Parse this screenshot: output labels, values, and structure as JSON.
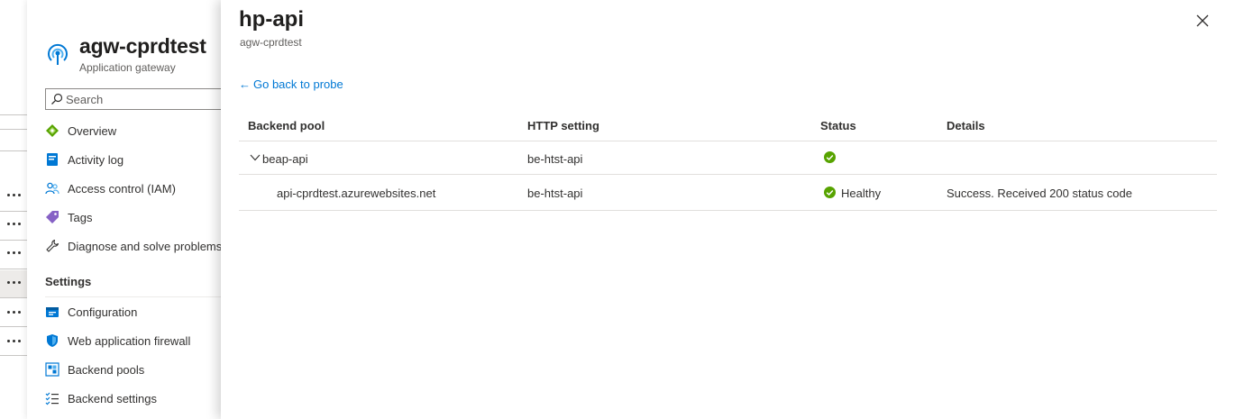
{
  "resource": {
    "name": "agw-cprdtest",
    "type": "Application gateway",
    "search_placeholder": "Search"
  },
  "nav": {
    "items": [
      {
        "label": "Overview",
        "icon": "overview-icon"
      },
      {
        "label": "Activity log",
        "icon": "activity-log-icon"
      },
      {
        "label": "Access control (IAM)",
        "icon": "people-icon"
      },
      {
        "label": "Tags",
        "icon": "tag-icon"
      },
      {
        "label": "Diagnose and solve problems",
        "icon": "wrench-icon"
      }
    ],
    "settings_header": "Settings",
    "settings_items": [
      {
        "label": "Configuration",
        "icon": "configuration-icon"
      },
      {
        "label": "Web application firewall",
        "icon": "shield-icon"
      },
      {
        "label": "Backend pools",
        "icon": "backend-pool-icon"
      },
      {
        "label": "Backend settings",
        "icon": "list-settings-icon"
      }
    ]
  },
  "panel": {
    "title": "hp-api",
    "subtitle": "agw-cprdtest",
    "back_link": "Go back to probe",
    "columns": [
      "Backend pool",
      "HTTP setting",
      "Status",
      "Details"
    ],
    "rows": [
      {
        "pool": "beap-api",
        "http_setting": "be-htst-api",
        "status": "",
        "details": "",
        "expanded": true
      },
      {
        "pool": "api-cprdtest.azurewebsites.net",
        "http_setting": "be-htst-api",
        "status": "Healthy",
        "details": "Success. Received 200 status code"
      }
    ]
  },
  "colors": {
    "accent": "#0078d4",
    "healthy": "#57a300"
  }
}
